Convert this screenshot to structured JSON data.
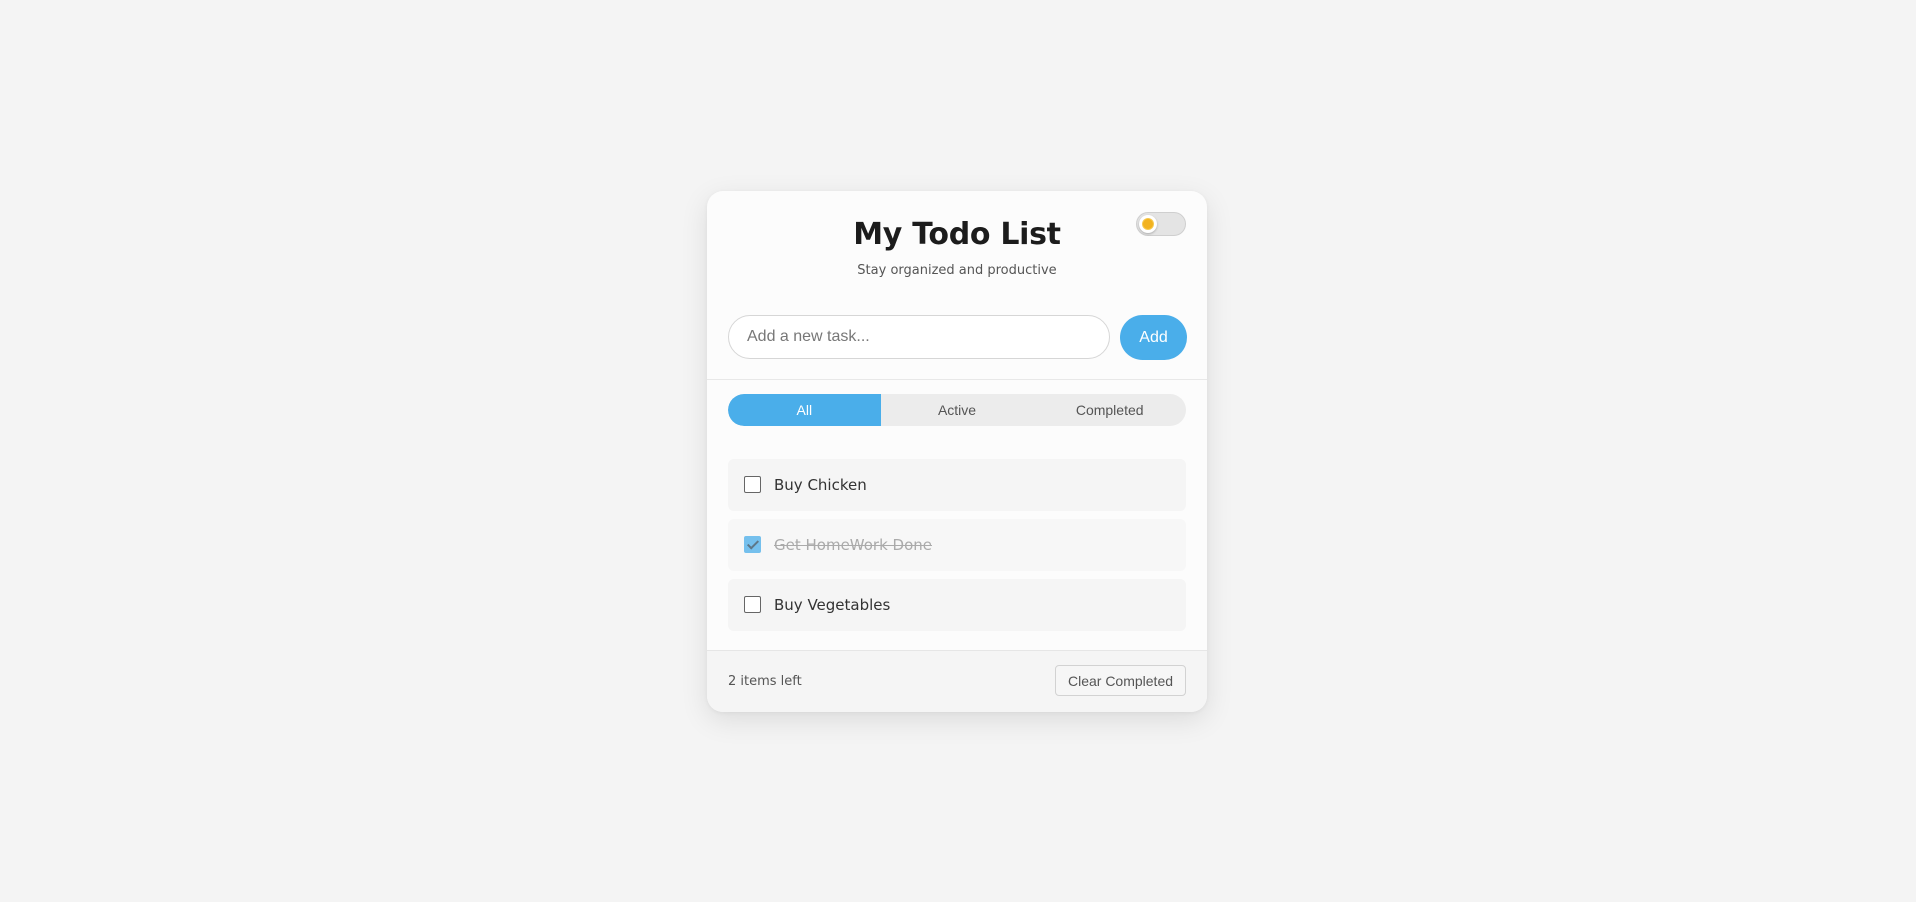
{
  "header": {
    "title": "My Todo List",
    "subtitle": "Stay organized and productive",
    "theme_toggle": {
      "state": "light",
      "icon": "sun-icon"
    }
  },
  "new_task": {
    "placeholder": "Add a new task...",
    "value": "",
    "add_label": "Add"
  },
  "filters": {
    "tabs": [
      {
        "label": "All",
        "active": true
      },
      {
        "label": "Active",
        "active": false
      },
      {
        "label": "Completed",
        "active": false
      }
    ]
  },
  "todos": [
    {
      "text": "Buy Chicken",
      "completed": false
    },
    {
      "text": "Get HomeWork Done",
      "completed": true
    },
    {
      "text": "Buy Vegetables",
      "completed": false
    }
  ],
  "footer": {
    "items_left": "2 items left",
    "clear_label": "Clear Completed"
  },
  "colors": {
    "accent": "#4aaeea",
    "background": "#f4f4f4",
    "card": "#fcfcfc",
    "sun": "#f2b21e"
  }
}
